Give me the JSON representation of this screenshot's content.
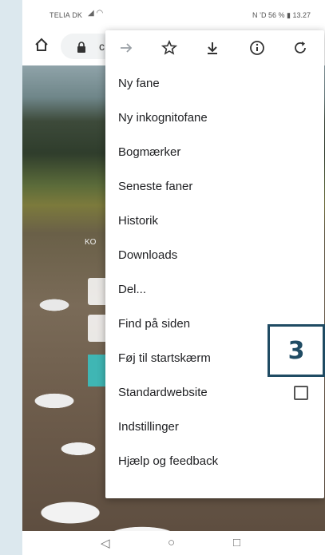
{
  "status_bar": {
    "carrier": "TELIA DK",
    "right_text": "N ’D 56 % ▮ 13.27"
  },
  "address_bar": {
    "url_fragment": "c"
  },
  "page_content": {
    "fragment": "KO"
  },
  "menu": {
    "toolbar": [
      {
        "name": "forward-icon",
        "glyph": "→"
      },
      {
        "name": "bookmark-star-icon",
        "glyph": "☆"
      },
      {
        "name": "download-icon",
        "glyph": "⤓"
      },
      {
        "name": "info-icon",
        "glyph": "ⓘ"
      },
      {
        "name": "reload-icon",
        "glyph": "↻"
      }
    ],
    "items": [
      {
        "label": "Ny fane"
      },
      {
        "label": "Ny inkognitofane"
      },
      {
        "label": "Bogmærker"
      },
      {
        "label": "Seneste faner"
      },
      {
        "label": "Historik"
      },
      {
        "label": "Downloads"
      },
      {
        "label": "Del..."
      },
      {
        "label": "Find på siden"
      },
      {
        "label": "Føj til startskærm"
      },
      {
        "label": "Standardwebsite"
      },
      {
        "label": "Indstillinger"
      },
      {
        "label": "Hjælp og feedback"
      }
    ]
  },
  "callout": {
    "number": "3"
  },
  "nav_bar": {
    "back_glyph": "◁",
    "home_glyph": "○",
    "recents_glyph": "□"
  }
}
